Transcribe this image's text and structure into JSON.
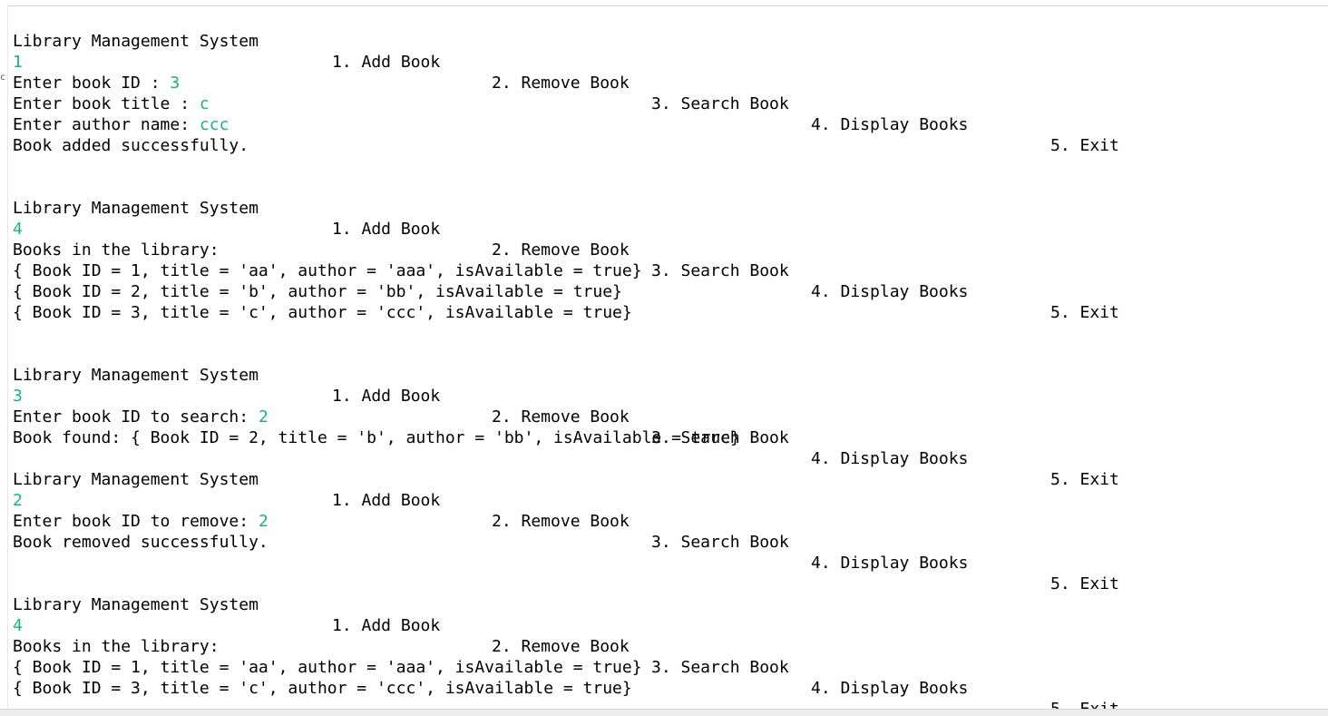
{
  "menu": {
    "title": "Library Management System",
    "opt1": "1. Add Book",
    "opt2": "2. Remove Book",
    "opt3": "3. Search Book",
    "opt4": "4. Display Books",
    "opt5": "5. Exit"
  },
  "gutter_char": "c",
  "sections": [
    {
      "choice": "1",
      "prompts": [
        {
          "label": "Enter book ID : ",
          "value": "3"
        },
        {
          "label": "Enter book title : ",
          "value": "c"
        },
        {
          "label": "Enter author name: ",
          "value": "ccc"
        }
      ],
      "result": "Book added successfully."
    },
    {
      "choice": "4",
      "header": "Books in the library:",
      "books": [
        "{ Book ID = 1, title = 'aa', author = 'aaa', isAvailable = true}",
        "{ Book ID = 2, title = 'b', author = 'bb', isAvailable = true}",
        "{ Book ID = 3, title = 'c', author = 'ccc', isAvailable = true}"
      ]
    },
    {
      "choice": "3",
      "prompt": {
        "label": "Enter book ID to search: ",
        "value": "2"
      },
      "result": "Book found: { Book ID = 2, title = 'b', author = 'bb', isAvailable = true}"
    },
    {
      "choice": "2",
      "prompt": {
        "label": "Enter book ID to remove: ",
        "value": "2"
      },
      "result": "Book removed successfully."
    },
    {
      "choice": "4",
      "header": "Books in the library:",
      "books": [
        "{ Book ID = 1, title = 'aa', author = 'aaa', isAvailable = true}",
        "{ Book ID = 3, title = 'c', author = 'ccc', isAvailable = true}"
      ]
    }
  ],
  "colors": {
    "text": "#000000",
    "user_input": "#17b380",
    "background": "#ffffff"
  }
}
